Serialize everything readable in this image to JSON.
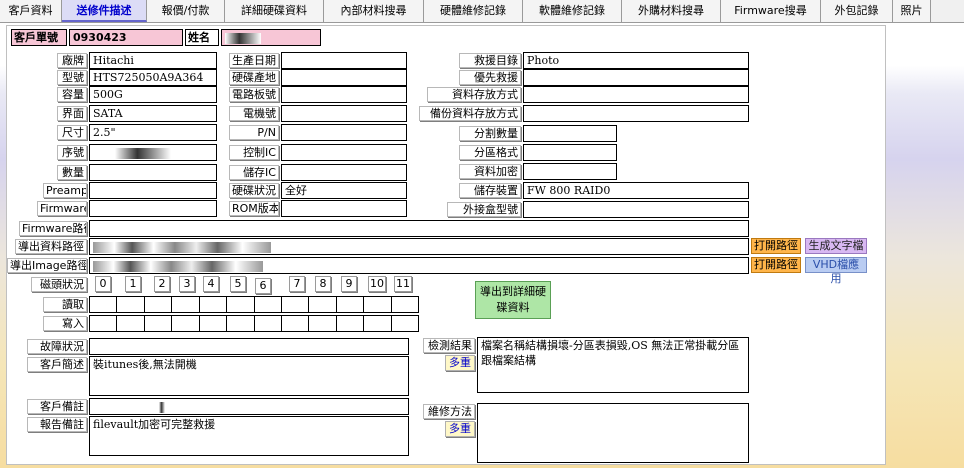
{
  "tabs": [
    "客戶資料",
    "送修件描述",
    "報價/付款",
    "詳細硬碟資料",
    "內部材料搜尋",
    "硬體維修記錄",
    "軟體維修記錄",
    "外購材料搜尋",
    "Firmware搜尋",
    "外包記錄",
    "照片"
  ],
  "customer": {
    "id_label": "客戶單號",
    "id_value": "0930423",
    "name_label": "姓名"
  },
  "fields": {
    "brand_label": "廠牌",
    "brand": "Hitachi",
    "model_label": "型號",
    "model": "HTS725050A9A364",
    "capacity_label": "容量",
    "capacity": "500G",
    "interface_label": "界面",
    "interface": "SATA",
    "size_label": "尺寸",
    "size": "2.5\"",
    "serial_label": "序號",
    "quantity_label": "數量",
    "quantity": "",
    "preamp_label": "Preamp",
    "preamp": "",
    "firmware_label": "Firmware",
    "firmware": "",
    "mfg_date_label": "生產日期",
    "mfg_date": "",
    "hdd_origin_label": "硬碟產地",
    "hdd_origin": "",
    "pcb_no_label": "電路板號",
    "pcb_no": "",
    "motor_no_label": "電機號",
    "motor_no": "",
    "pn_label": "P/N",
    "pn": "",
    "ctrl_ic_label": "控制IC",
    "ctrl_ic": "",
    "mem_ic_label": "儲存IC",
    "mem_ic": "",
    "hdd_status_label": "硬碟狀況",
    "hdd_status": "全好",
    "rom_label": "ROM版本",
    "rom": "",
    "rescue_dir_label": "救援目錄",
    "rescue_dir": "Photo",
    "priority_label": "優先救援",
    "priority": "",
    "storage_method_label": "資料存放方式",
    "storage_method": "",
    "backup_method_label": "備份資料存放方式",
    "backup_method": "",
    "partition_count_label": "分割數量",
    "partition_count": "",
    "partition_format_label": "分區格式",
    "partition_format": "",
    "encryption_label": "資料加密",
    "encryption": "",
    "storage_device_label": "儲存裝置",
    "storage_device": "FW 800 RAID0",
    "enclosure_label": "外接盒型號",
    "enclosure": ""
  },
  "paths": {
    "firmware_path_label": "Firmware路徑",
    "export_data_path_label": "導出資料路徑",
    "export_image_path_label": "導出Image路徑",
    "open_path_label": "打開路徑",
    "gen_text_label": "生成文字檔",
    "vhd_label": "VHD檔應用"
  },
  "heads": {
    "label": "磁頭狀況",
    "numbers": [
      "0",
      "1",
      "2",
      "3",
      "4",
      "5",
      "6",
      "7",
      "8",
      "9",
      "10",
      "11"
    ],
    "read_label": "讀取",
    "write_label": "寫入",
    "export_button": "導出到詳細硬碟資料"
  },
  "notes": {
    "fault_label": "故障狀況",
    "fault": "",
    "customer_desc_label": "客戶簡述",
    "customer_desc": "裝itunes後,無法開機",
    "customer_note_label": "客戶備註",
    "report_note_label": "報告備註",
    "report_note": "filevault加密可完整救援",
    "detect_result_label": "檢測結果",
    "detect_result": "檔案名稱結構損壞-分區表損毀,OS 無法正常掛載分區跟檔案結構",
    "repair_method_label": "維修方法",
    "repair_method": "",
    "multi_label": "多重"
  },
  "colors": {
    "active_tab": "#0000cc",
    "customer_pink": "#f7c6d6",
    "open_path": "#ffb54a",
    "gen_text": "#d8b8f2",
    "vhd": "#b9ccf2",
    "export_green": "#aee6a6"
  }
}
